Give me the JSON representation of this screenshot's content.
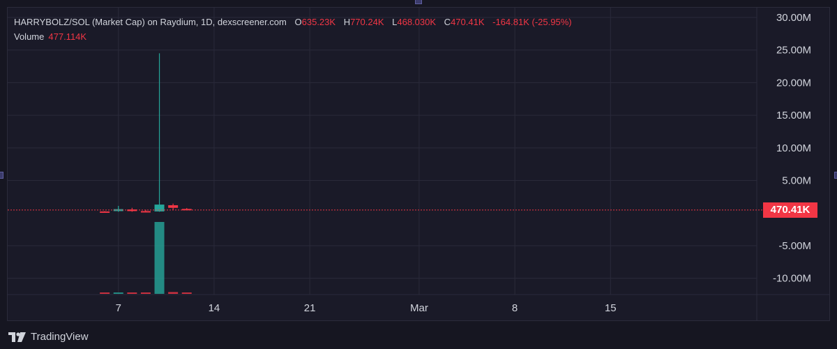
{
  "legend": {
    "pair_text": "HARRYBOLZ/SOL (Market Cap) on Raydium, 1D, dexscreener.com",
    "open_label": "O",
    "open_value": "635.23K",
    "high_label": "H",
    "high_value": "770.24K",
    "low_label": "L",
    "low_value": "468.030K",
    "close_label": "C",
    "close_value": "470.41K",
    "change_text": "-164.81K (-25.95%)",
    "volume_label": "Volume",
    "volume_value": "477.114K"
  },
  "price_tag": "470.41K",
  "brand": "TradingView",
  "colors": {
    "background": "#161621",
    "up": "#26a69a",
    "down": "#f23645",
    "grid": "#2a2a3a",
    "text": "#d1d4dc"
  },
  "chart_data": {
    "type": "candlestick",
    "y_ticks": [
      "30.00M",
      "25.00M",
      "20.00M",
      "15.00M",
      "10.00M",
      "5.00M",
      "-5.00M",
      "-10.00M"
    ],
    "y_tick_values": [
      30000000,
      25000000,
      20000000,
      15000000,
      10000000,
      5000000,
      -5000000,
      -10000000
    ],
    "ylim": [
      -12500000,
      31500000
    ],
    "x_ticks": [
      "7",
      "14",
      "21",
      "Mar",
      "8",
      "15"
    ],
    "x_tick_days": [
      7,
      14,
      21,
      29,
      36,
      43
    ],
    "xlim": [
      -1.1,
      53.7
    ],
    "last_price": 470410,
    "candles": [
      {
        "day": 6,
        "open": 250000,
        "high": 300000,
        "low": 100000,
        "close": 150000
      },
      {
        "day": 7,
        "open": 300000,
        "high": 1100000,
        "low": 200000,
        "close": 600000
      },
      {
        "day": 8,
        "open": 550000,
        "high": 800000,
        "low": 200000,
        "close": 300000
      },
      {
        "day": 9,
        "open": 300000,
        "high": 500000,
        "low": 150000,
        "close": 200000
      },
      {
        "day": 10,
        "open": 250000,
        "high": 24500000,
        "low": 200000,
        "close": 1300000
      },
      {
        "day": 11,
        "open": 1200000,
        "high": 1450000,
        "low": 500000,
        "close": 800000
      },
      {
        "day": 12,
        "open": 635230,
        "high": 770240,
        "low": 468030,
        "close": 470410
      }
    ],
    "volume": [
      {
        "day": 6,
        "value": 300000,
        "direction": "down"
      },
      {
        "day": 7,
        "value": 500000,
        "direction": "up"
      },
      {
        "day": 8,
        "value": 450000,
        "direction": "down"
      },
      {
        "day": 9,
        "value": 300000,
        "direction": "down"
      },
      {
        "day": 10,
        "value": 28000000,
        "direction": "up"
      },
      {
        "day": 11,
        "value": 700000,
        "direction": "down"
      },
      {
        "day": 12,
        "value": 477114,
        "direction": "down"
      }
    ],
    "volume_max": 28000000
  }
}
